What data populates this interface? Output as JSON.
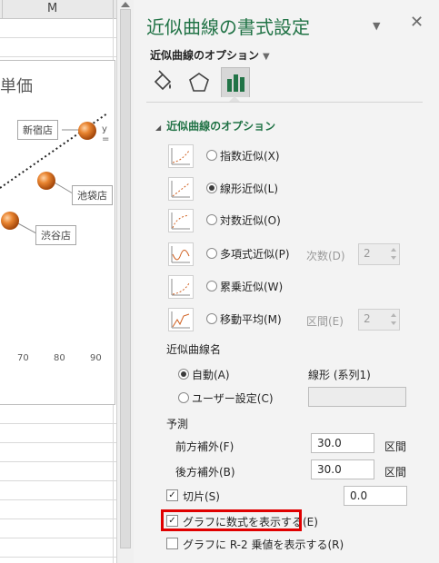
{
  "spreadsheet": {
    "column_letter": "M",
    "chart": {
      "title": "単価",
      "x_ticks": [
        "70",
        "80",
        "90"
      ],
      "callouts": [
        "新宿店",
        "池袋店",
        "渋谷店"
      ],
      "equation_fragment": "y ="
    }
  },
  "pane": {
    "title": "近似曲線の書式設定",
    "menu_label": "近似曲線のオプション",
    "section_title": "近似曲線のオプション",
    "trend_types": [
      {
        "label": "指数近似(X)",
        "selected": false
      },
      {
        "label": "線形近似(L)",
        "selected": true
      },
      {
        "label": "対数近似(O)",
        "selected": false
      },
      {
        "label": "多項式近似(P)",
        "selected": false
      },
      {
        "label": "累乗近似(W)",
        "selected": false
      },
      {
        "label": "移動平均(M)",
        "selected": false
      }
    ],
    "order_label": "次数(D)",
    "order_value": "2",
    "period_label": "区間(E)",
    "period_value": "2",
    "name_heading": "近似曲線名",
    "name_auto_label": "自動(A)",
    "name_auto_value": "線形 (系列1)",
    "name_custom_label": "ユーザー設定(C)",
    "forecast_heading": "予測",
    "forward_label": "前方補外(F)",
    "forward_value": "30.0",
    "forward_unit": "区間",
    "backward_label": "後方補外(B)",
    "backward_value": "30.0",
    "backward_unit": "区間",
    "intercept_label": "切片(S)",
    "intercept_value": "0.0",
    "show_equation_label": "グラフに数式を表示する(E)",
    "show_r2_label": "グラフに R-2 乗値を表示する(R)",
    "accent_color": "#217346",
    "highlight_color": "#e00000"
  }
}
